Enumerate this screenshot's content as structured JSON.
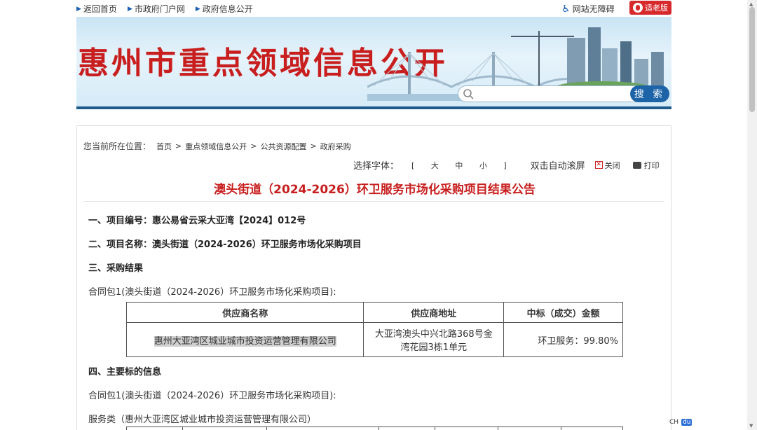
{
  "topnav": {
    "items": [
      "返回首页",
      "市政府门户网",
      "政府信息公开"
    ],
    "accessibility": "网站无障碍",
    "elder_mode": "适老版"
  },
  "banner": {
    "title": "惠州市重点领域信息公开",
    "search_placeholder": "",
    "search_button": "搜 索"
  },
  "breadcrumb": {
    "label": "您当前所在位置：",
    "items": [
      "首页",
      "重点领域信息公开",
      "公共资源配置",
      "政府采购"
    ],
    "sep": ">"
  },
  "tools": {
    "font_label": "选择字体：",
    "bracket_open": "[",
    "sizes": [
      "大",
      "中",
      "小"
    ],
    "bracket_close": "]",
    "autoscroll": "双击自动滚屏",
    "close": "关闭",
    "print": "打印"
  },
  "article": {
    "title": "澳头街道（2024-2026）环卫服务市场化采购项目结果公告",
    "s1": "一、项目编号：惠公易省云采大亚湾【2024】012号",
    "s2": "二、项目名称：澳头街道（2024-2026）环卫服务市场化采购项目",
    "s3": "三、采购结果",
    "pkg1": "合同包1(澳头街道（2024-2026）环卫服务市场化采购项目):",
    "table": {
      "headers": [
        "供应商名称",
        "供应商地址",
        "中标（成交）金额"
      ],
      "rows": [
        [
          "惠州大亚湾区城业城市投资运营管理有限公司",
          "大亚湾澳头中兴北路368号金湾花园3栋1单元",
          "环卫服务：99.80%"
        ]
      ]
    },
    "s4": "四、主要标的信息",
    "pkg2": "合同包1(澳头街道（2024-2026）环卫服务市场化采购项目):",
    "service": "服务类（惠州大亚湾区城业城市投资运营管理有限公司）"
  },
  "ime": {
    "lang": "CH",
    "brand": "du"
  }
}
